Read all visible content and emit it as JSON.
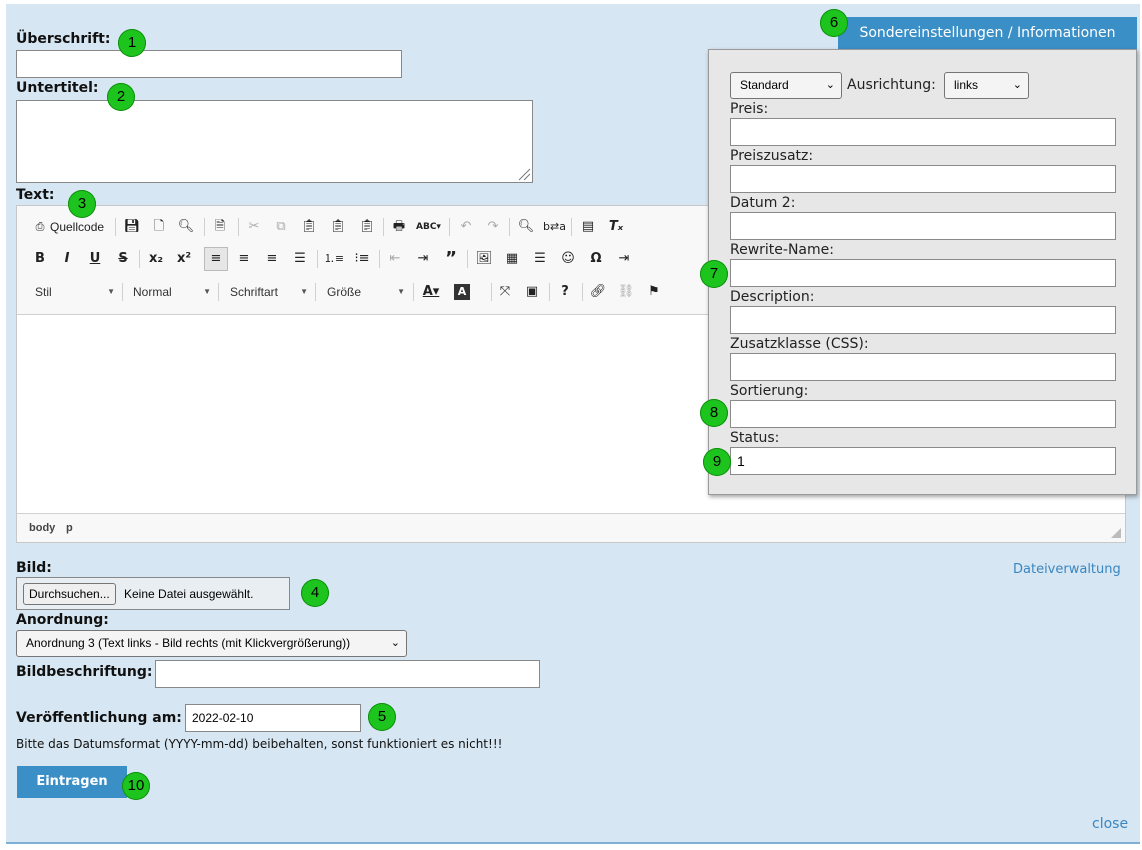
{
  "form": {
    "heading_label": "Überschrift:",
    "heading_value": "",
    "subtitle_label": "Untertitel:",
    "subtitle_value": "",
    "text_label": "Text:",
    "image_label": "Bild:",
    "file_button": "Durchsuchen...",
    "file_status": "Keine Datei ausgewählt.",
    "file_manager_link": "Dateiverwaltung",
    "arrangement_label": "Anordnung:",
    "arrangement_value": "Anordnung 3 (Text links - Bild rechts (mit Klickvergrößerung))",
    "caption_label": "Bildbeschriftung:",
    "caption_value": "",
    "publish_label": "Veröffentlichung am:",
    "publish_value": "2022-02-10",
    "date_hint": "Bitte das Datumsformat (YYYY-mm-dd) beibehalten, sonst funktioniert es nicht!!!",
    "submit_button": "Eintragen",
    "close_link": "close"
  },
  "editor": {
    "source_label": "Quellcode",
    "style_combo": "Stil",
    "format_combo": "Normal",
    "font_combo": "Schriftart",
    "size_combo": "Größe",
    "path": [
      "body",
      "p"
    ]
  },
  "panel": {
    "tab_label": "Sondereinstellungen / Informationen",
    "mode_select": "Standard",
    "align_label": "Ausrichtung:",
    "align_select": "links",
    "fields": [
      {
        "label": "Preis:",
        "value": ""
      },
      {
        "label": "Preiszusatz:",
        "value": ""
      },
      {
        "label": "Datum 2:",
        "value": ""
      },
      {
        "label": "Rewrite-Name:",
        "value": ""
      },
      {
        "label": "Description:",
        "value": ""
      },
      {
        "label": "Zusatzklasse (CSS):",
        "value": ""
      },
      {
        "label": "Sortierung:",
        "value": ""
      },
      {
        "label": "Status:",
        "value": "1"
      }
    ]
  },
  "badges": [
    "1",
    "2",
    "3",
    "4",
    "5",
    "6",
    "7",
    "8",
    "9",
    "10"
  ],
  "colors": {
    "background": "#d6e6f2",
    "accent": "#3b8fc7",
    "badge": "#1ec41e",
    "link": "#3a86c0"
  }
}
